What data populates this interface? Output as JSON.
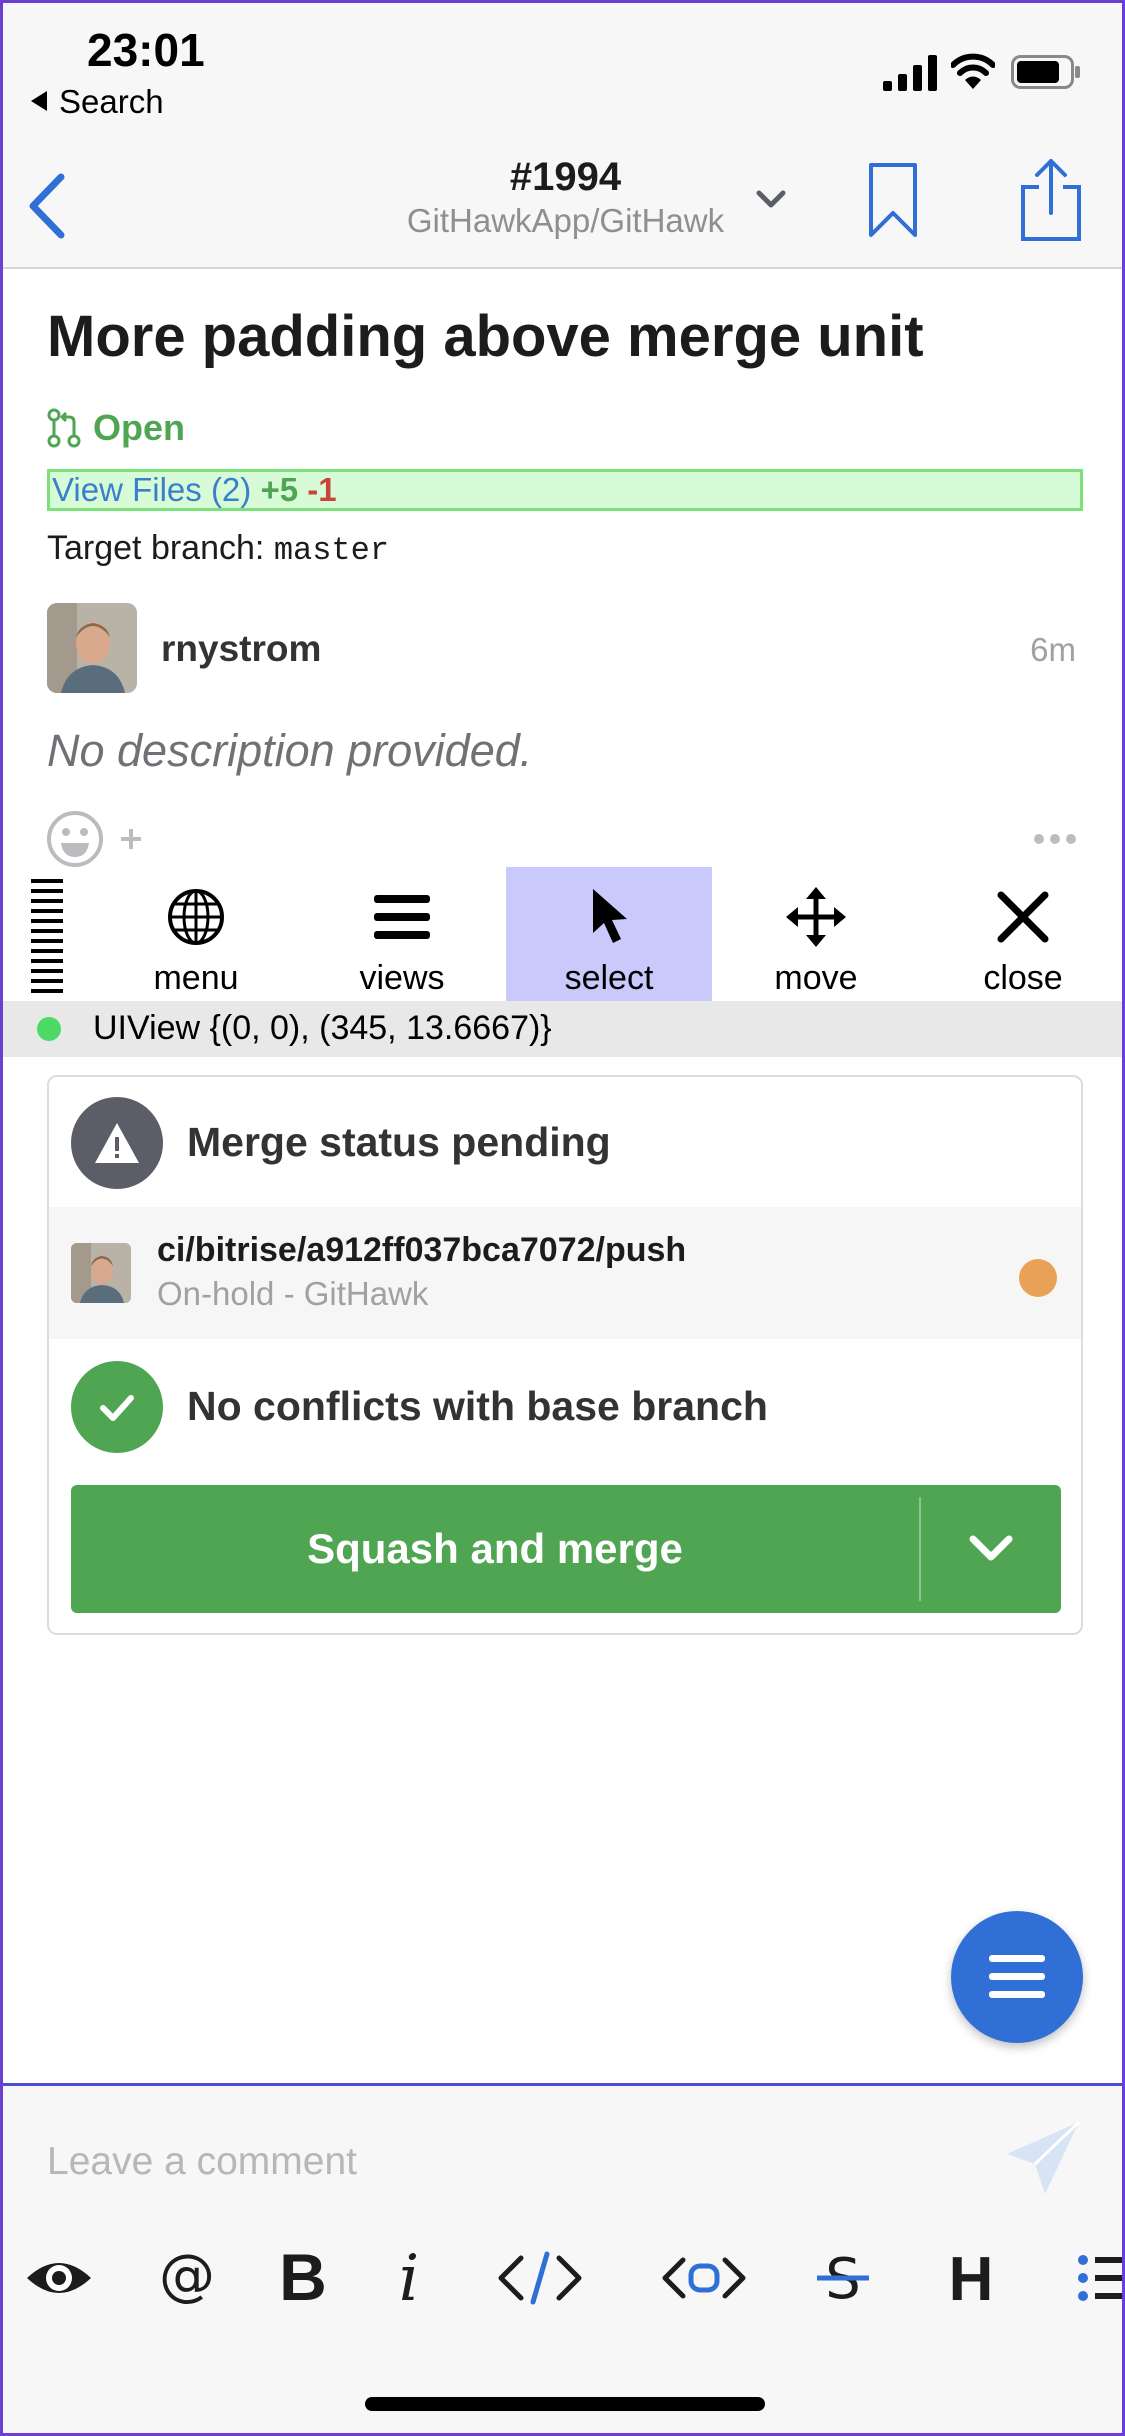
{
  "status_bar": {
    "time": "23:01",
    "back_label": "Search"
  },
  "nav": {
    "number": "#1994",
    "repo": "GitHawkApp/GitHawk"
  },
  "issue": {
    "title": "More padding above merge unit",
    "state": "Open",
    "files_label": "View Files (2)",
    "additions": "+5",
    "deletions": "-1",
    "target_label": "Target branch:",
    "target_branch": "master"
  },
  "author": {
    "name": "rnystrom",
    "time_ago": "6m"
  },
  "description": "No description provided.",
  "flex_toolbar": {
    "tools": [
      {
        "label": "menu",
        "icon": "globe-icon"
      },
      {
        "label": "views",
        "icon": "hamburger-icon"
      },
      {
        "label": "select",
        "icon": "cursor-arrow-icon",
        "active": true
      },
      {
        "label": "move",
        "icon": "move-arrows-icon"
      },
      {
        "label": "close",
        "icon": "close-x-icon"
      }
    ],
    "selection_info": "UIView {(0, 0), (345, 13.6667)}"
  },
  "merge": {
    "status_title": "Merge status pending",
    "ci_context": "ci/bitrise/a912ff037bca7072/push",
    "ci_description": "On-hold - GitHawk",
    "conflicts_title": "No conflicts with base branch",
    "merge_button": "Squash and merge",
    "colors": {
      "pending": "#e9a158",
      "success": "#4fa552",
      "neutral": "#5b5e66"
    }
  },
  "comment": {
    "placeholder": "Leave a comment"
  },
  "formatting_toolbar": [
    "eye-icon",
    "mention-icon",
    "bold-icon",
    "italic-icon",
    "code-icon",
    "code-block-icon",
    "strikethrough-icon",
    "heading-icon",
    "list-icon"
  ],
  "colors": {
    "accent": "#2f6fd6",
    "frame": "#6a3fd6",
    "green": "#4fa552"
  }
}
